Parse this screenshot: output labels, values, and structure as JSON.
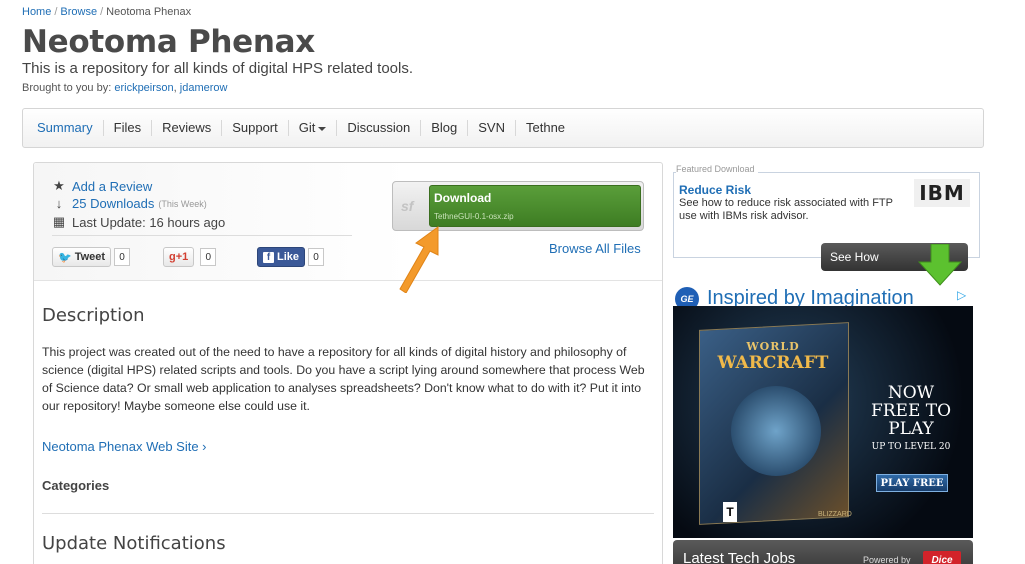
{
  "breadcrumb": {
    "home": "Home",
    "browse": "Browse",
    "current": "Neotoma Phenax",
    "sep": "/"
  },
  "project": {
    "title": "Neotoma Phenax",
    "summary": "This is a repository for all kinds of digital HPS related tools.",
    "brought_by_prefix": "Brought to you by:",
    "author1": "erickpeirson",
    "author_sep": ",",
    "author2": "jdamerow"
  },
  "tabs": [
    {
      "label": "Summary",
      "active": true
    },
    {
      "label": "Files"
    },
    {
      "label": "Reviews"
    },
    {
      "label": "Support"
    },
    {
      "label": "Git"
    },
    {
      "label": "Discussion"
    },
    {
      "label": "Blog"
    },
    {
      "label": "SVN"
    },
    {
      "label": "Tethne"
    }
  ],
  "stats": {
    "add_review": "Add a Review",
    "downloads": "25 Downloads",
    "downloads_period": "(This Week)",
    "last_update": "Last Update: 16 hours ago"
  },
  "social": {
    "tweet": "Tweet",
    "tweet_count": "0",
    "gplus": "+1",
    "gplus_count": "0",
    "like": "Like",
    "like_count": "0"
  },
  "download": {
    "sf_logo": "sf",
    "label": "Download",
    "filename": "TethneGUI-0.1-osx.zip",
    "browse_all": "Browse All Files"
  },
  "description": {
    "heading": "Description",
    "text": "This project was created out of the need to have a repository for all kinds of digital history and philosophy of science (digital HPS) related scripts and tools. Do you have a script lying around somewhere that process Web of Science data? Or small web application to analyses spreadsheets? Don't know what to do with it? Put it into our repository! Maybe someone else could use it.",
    "website_link": "Neotoma Phenax Web Site ›",
    "categories": "Categories",
    "update_notifications": "Update Notifications"
  },
  "featured": {
    "label": "Featured Download",
    "title": "Reduce Risk",
    "body": "See how to reduce risk associated with FTP use with IBMs risk advisor.",
    "logo": "IBM",
    "see_how": "See How"
  },
  "ads": {
    "ge_logo": "GE",
    "ge_text": "Inspired by Imagination",
    "wow_world": "WORLD",
    "wow_craft": "WARCRAFT",
    "now_free": "NOW FREE TO PLAY",
    "up_to": "UP TO LEVEL 20",
    "play_free": "PLAY FREE",
    "rating": "T",
    "publisher": "BLIZZARD"
  },
  "tech_jobs": {
    "title": "Latest Tech Jobs",
    "powered_by": "Powered by",
    "dice": "Dice"
  },
  "colors": {
    "link": "#1f6eb5",
    "download_green": "#4b8d2c",
    "arrow_orange": "#f39a2b"
  }
}
